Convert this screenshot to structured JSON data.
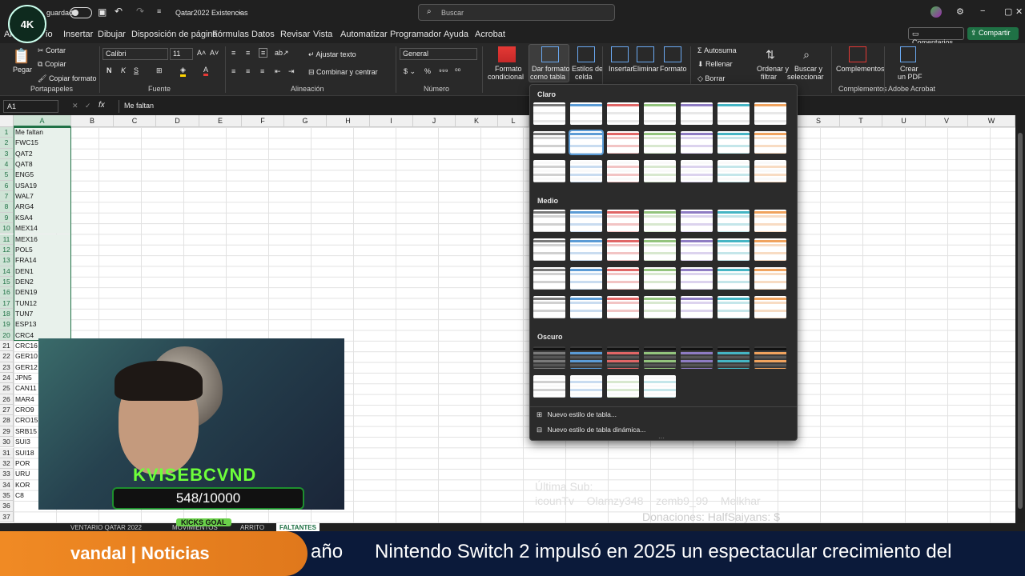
{
  "titlebar": {
    "autosave_label": "guardado",
    "filename": "Qatar2022 Existencias",
    "search_placeholder": "Buscar"
  },
  "menu": {
    "tabs": [
      "Ar",
      "io",
      "Insertar",
      "Dibujar",
      "Disposición de página",
      "Fórmulas",
      "Datos",
      "Revisar",
      "Vista",
      "Automatizar",
      "Programador",
      "Ayuda",
      "Acrobat"
    ],
    "comments_label": "Comentarios",
    "share_label": "Compartir"
  },
  "ribbon": {
    "paste": "Pegar",
    "cut": "Cortar",
    "copy": "Copiar",
    "format_painter": "Copiar formato",
    "clipboard_group": "Portapapeles",
    "font_name": "Calibri",
    "font_size": "11",
    "bold": "N",
    "italic": "K",
    "underline": "S",
    "font_group": "Fuente",
    "wrap_text": "Ajustar texto",
    "merge_center": "Combinar y centrar",
    "alignment_group": "Alineación",
    "number_format": "General",
    "number_group": "Número",
    "cond_format_1": "Formato",
    "cond_format_2": "condicional",
    "table_format_1": "Dar formato",
    "table_format_2": "como tabla",
    "cell_styles_1": "Estilos de",
    "cell_styles_2": "celda",
    "insert": "Insertar",
    "delete": "Eliminar",
    "format": "Formato",
    "autosum": "Autosuma",
    "fill": "Rellenar",
    "clear": "Borrar",
    "sort_1": "Ordenar y",
    "sort_2": "filtrar",
    "find_1": "Buscar y",
    "find_2": "seleccionar",
    "addins": "Complementos",
    "addins_group": "Complementos",
    "pdf_1": "Crear",
    "pdf_2": "un PDF",
    "acrobat_group": "Adobe Acrobat",
    "percent": "%"
  },
  "formula_bar": {
    "name_box": "A1",
    "fx": "fx",
    "content": "Me faltan"
  },
  "columns": [
    "A",
    "B",
    "C",
    "D",
    "E",
    "F",
    "G",
    "H",
    "I",
    "J",
    "K",
    "L",
    "S",
    "T",
    "U",
    "V",
    "W"
  ],
  "rows": [
    {
      "n": "1",
      "a": "Me faltan"
    },
    {
      "n": "2",
      "a": "FWC15"
    },
    {
      "n": "3",
      "a": "QAT2"
    },
    {
      "n": "4",
      "a": "QAT8"
    },
    {
      "n": "5",
      "a": "ENG5"
    },
    {
      "n": "6",
      "a": "USA19"
    },
    {
      "n": "7",
      "a": "WAL7"
    },
    {
      "n": "8",
      "a": "ARG4"
    },
    {
      "n": "9",
      "a": "KSA4"
    },
    {
      "n": "10",
      "a": "MEX14"
    },
    {
      "n": "11",
      "a": "MEX16"
    },
    {
      "n": "12",
      "a": "POL5"
    },
    {
      "n": "13",
      "a": "FRA14"
    },
    {
      "n": "14",
      "a": "DEN1"
    },
    {
      "n": "15",
      "a": "DEN2"
    },
    {
      "n": "16",
      "a": "DEN19"
    },
    {
      "n": "17",
      "a": "TUN12"
    },
    {
      "n": "18",
      "a": "TUN7"
    },
    {
      "n": "19",
      "a": "ESP13"
    },
    {
      "n": "20",
      "a": "CRC4"
    },
    {
      "n": "21",
      "a": "CRC16"
    },
    {
      "n": "22",
      "a": "GER10"
    },
    {
      "n": "23",
      "a": "GER12"
    },
    {
      "n": "24",
      "a": "JPN5"
    },
    {
      "n": "25",
      "a": "CAN11"
    },
    {
      "n": "26",
      "a": "MAR4"
    },
    {
      "n": "27",
      "a": "CRO9"
    },
    {
      "n": "28",
      "a": "CRO15"
    },
    {
      "n": "29",
      "a": "SRB15"
    },
    {
      "n": "30",
      "a": "SUI3"
    },
    {
      "n": "31",
      "a": "SUI18"
    },
    {
      "n": "32",
      "a": "POR"
    },
    {
      "n": "33",
      "a": "URU"
    },
    {
      "n": "34",
      "a": "KOR"
    },
    {
      "n": "35",
      "a": "C8"
    },
    {
      "n": "36",
      "a": ""
    },
    {
      "n": "37",
      "a": ""
    }
  ],
  "gallery": {
    "light_label": "Claro",
    "medium_label": "Medio",
    "dark_label": "Oscuro",
    "new_table_style": "Nuevo estilo de tabla...",
    "new_pivot_style": "Nuevo estilo de tabla dinámica..."
  },
  "sheet_tabs": [
    "VENTARIO QATAR 2022",
    "MOVIMIENTOS",
    "ARRITO",
    "FALTANTES"
  ],
  "overlay": {
    "last_sub_label": "Última Sub:",
    "subs_line": "icounTv    Olamzy348    zemb9_99    Melkhar",
    "donations_line": "Donaciones: HalfSaiyans: $",
    "kicks_counter": "548/10000",
    "kicks_label": "KICKS GOAL",
    "streamer_name": "KVISEBCVND",
    "logo_text": "4K"
  },
  "ticker": {
    "source": "vandal | Noticias",
    "headline": "año      Nintendo Switch 2 impulsó en 2025 un espectacular crecimiento del"
  },
  "colors": {
    "accent_green": "#2e7d32",
    "excel_green": "#1f7145",
    "ticker_orange": "#f08a24",
    "ticker_blue": "#0b1a3a"
  }
}
